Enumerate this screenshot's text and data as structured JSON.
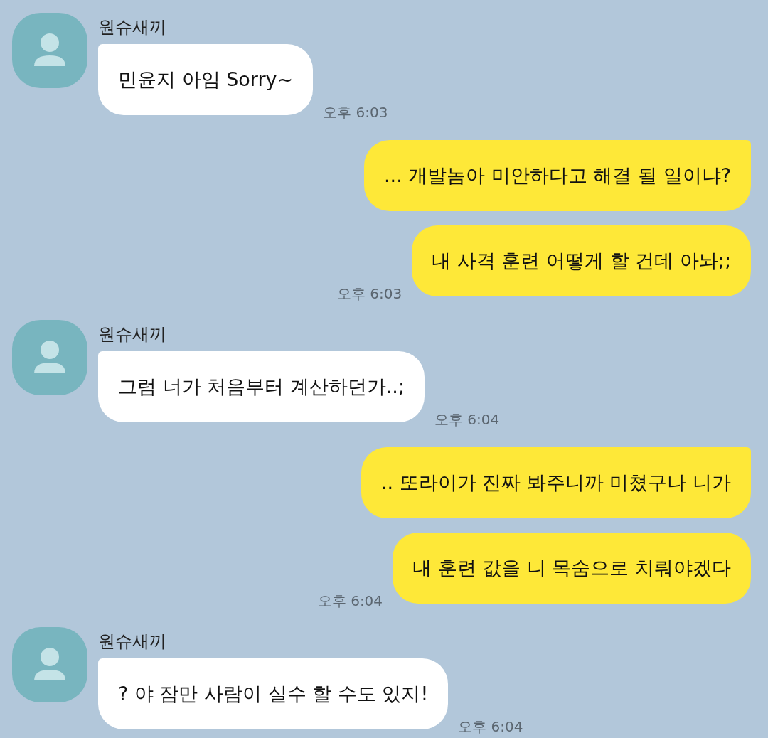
{
  "messages": [
    {
      "kind": "incoming",
      "sender": "원슈새끼",
      "bubbles": [
        {
          "text": "민윤지 아임 Sorry~"
        }
      ],
      "time": "오후 6:03"
    },
    {
      "kind": "outgoing",
      "bubbles": [
        {
          "text": "... 개발놈아 미안하다고 해결 될 일이냐?"
        },
        {
          "text": "내 사격 훈련 어떻게 할 건데 아놔;;"
        }
      ],
      "time": "오후 6:03"
    },
    {
      "kind": "incoming",
      "sender": "원슈새끼",
      "bubbles": [
        {
          "text": "그럼 너가 처음부터 계산하던가..;"
        }
      ],
      "time": "오후 6:04"
    },
    {
      "kind": "outgoing",
      "bubbles": [
        {
          "text": ".. 또라이가 진짜 봐주니까 미쳤구나 니가"
        },
        {
          "text": "내 훈련 값을 니 목숨으로 치뤄야겠다"
        }
      ],
      "time": "오후 6:04"
    },
    {
      "kind": "incoming",
      "sender": "원슈새끼",
      "bubbles": [
        {
          "text": "? 야 잠만 사람이 실수 할 수도 있지!"
        }
      ],
      "time": "오후 6:04"
    }
  ]
}
